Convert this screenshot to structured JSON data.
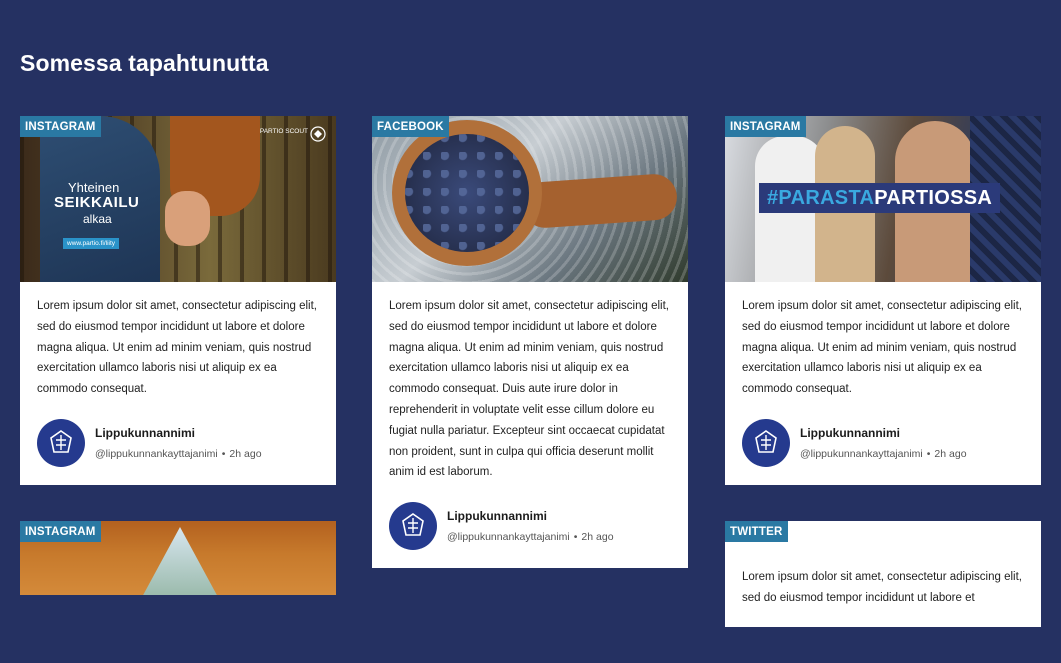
{
  "section_title": "Somessa tapahtunutta",
  "colors": {
    "background": "#253162",
    "badge": "#2a79a3",
    "avatar": "#253a8e"
  },
  "posts": [
    {
      "platform": "INSTAGRAM",
      "media": {
        "line1": "Yhteinen",
        "line2": "SEIKKAILU",
        "line3": "alkaa",
        "url": "www.partio.fi/liity",
        "logo": "PARTIO SCOUT"
      },
      "text": "Lorem ipsum dolor sit amet, consectetur adipiscing elit, sed do eiusmod tempor incididunt ut labore et dolore magna aliqua. Ut enim ad minim veniam, quis nostrud exercitation ullamco laboris nisi ut aliquip ex ea commodo consequat.",
      "author": "Lippukunnannimi",
      "handle": "@lippukunnankayttajanimi",
      "time": "2h ago"
    },
    {
      "platform": "FACEBOOK",
      "text": "Lorem ipsum dolor sit amet, consectetur adipiscing elit, sed do eiusmod tempor incididunt ut labore et dolore magna aliqua. Ut enim ad minim veniam, quis nostrud exercitation ullamco laboris nisi ut aliquip ex ea commodo consequat. Duis aute irure dolor in reprehenderit in voluptate velit esse cillum dolore eu fugiat nulla pariatur. Excepteur sint occaecat cupidatat non proident, sunt in culpa qui officia deserunt mollit anim id est laborum.",
      "author": "Lippukunnannimi",
      "handle": "@lippukunnankayttajanimi",
      "time": "2h ago"
    },
    {
      "platform": "INSTAGRAM",
      "media": {
        "hashtag_a": "#PARASTA",
        "hashtag_b": "PARTIOSSA"
      },
      "text": "Lorem ipsum dolor sit amet, consectetur adipiscing elit, sed do eiusmod tempor incididunt ut labore et dolore magna aliqua. Ut enim ad minim veniam, quis nostrud exercitation ullamco laboris nisi ut aliquip ex ea commodo consequat.",
      "author": "Lippukunnannimi",
      "handle": "@lippukunnankayttajanimi",
      "time": "2h ago"
    },
    {
      "platform": "INSTAGRAM"
    },
    {
      "platform": "TWITTER",
      "text": "Lorem ipsum dolor sit amet, consectetur adipiscing elit, sed do eiusmod tempor incididunt ut labore et"
    }
  ]
}
